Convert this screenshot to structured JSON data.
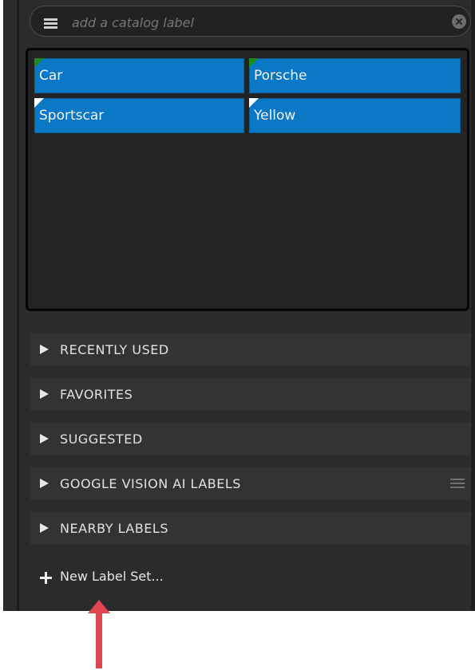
{
  "search": {
    "placeholder": "add a catalog label",
    "value": ""
  },
  "keywords": [
    {
      "label": "Car",
      "corner_color": "#1f8a1f"
    },
    {
      "label": "Porsche",
      "corner_color": "#1f8a1f"
    },
    {
      "label": "Sportscar",
      "corner_color": "#ffffff"
    },
    {
      "label": "Yellow",
      "corner_color": "#ffffff"
    }
  ],
  "sections": [
    {
      "title": "RECENTLY USED"
    },
    {
      "title": "FAVORITES"
    },
    {
      "title": "SUGGESTED"
    },
    {
      "title": "GOOGLE VISION AI LABELS",
      "has_menu": true
    },
    {
      "title": "NEARBY LABELS"
    }
  ],
  "new_label_set": {
    "label": "New Label Set..."
  },
  "icons": {
    "menu": "hamburger-icon",
    "clear": "clear-icon",
    "expand": "triangle-right-icon",
    "add": "plus-icon"
  },
  "colors": {
    "tag_fill": "#0a78c4",
    "annotation_arrow": "#e0464f",
    "panel_bg": "#2b2b2b"
  }
}
